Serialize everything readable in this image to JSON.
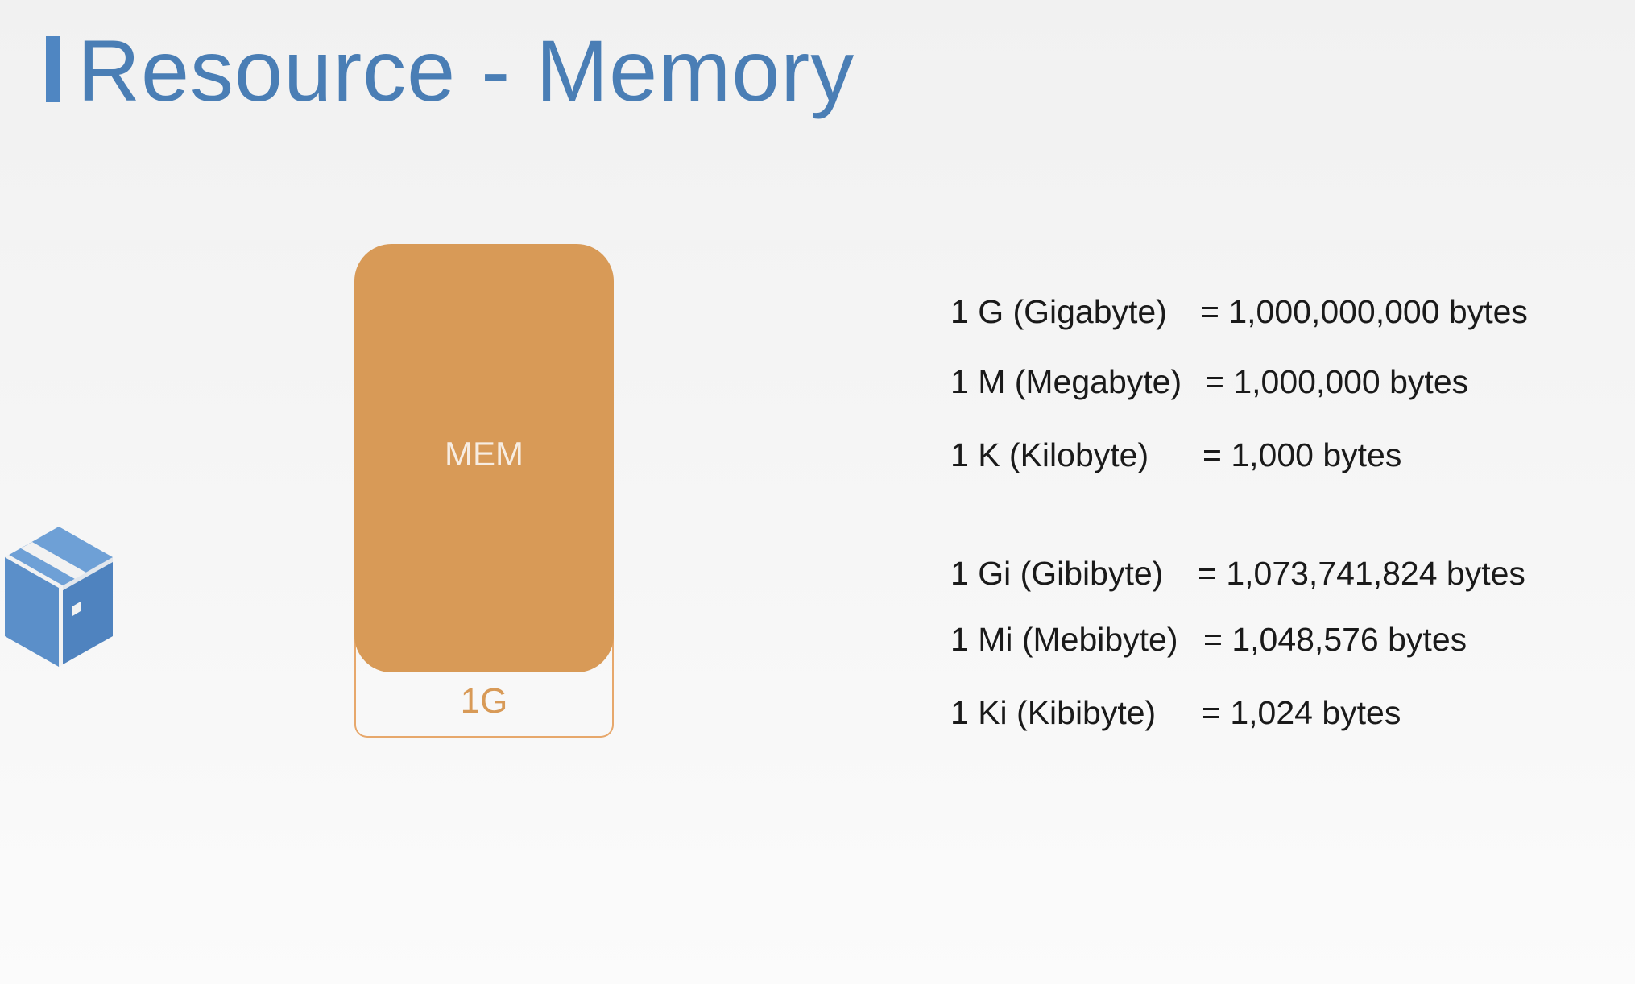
{
  "title": "Resource - Memory",
  "colors": {
    "title": "#4a7eb5",
    "accent_bar": "#4f86c2",
    "memory_block": "#d89a57",
    "memory_outline": "#e7a86c",
    "text": "#1a1a1a"
  },
  "icons": [
    "pod-box-icon"
  ],
  "memory_block": {
    "label": "MEM",
    "limit": "1G"
  },
  "units": {
    "decimal": [
      {
        "name": "1 G (Gigabyte)",
        "value": "= 1,000,000,000 bytes"
      },
      {
        "name": "1 M (Megabyte)",
        "value": "= 1,000,000 bytes"
      },
      {
        "name": "1 K (Kilobyte)",
        "value": "= 1,000 bytes"
      }
    ],
    "binary": [
      {
        "name": "1 Gi (Gibibyte)",
        "value": "= 1,073,741,824 bytes"
      },
      {
        "name": "1 Mi (Mebibyte)",
        "value": "= 1,048,576 bytes"
      },
      {
        "name": "1 Ki (Kibibyte)",
        "value": "= 1,024 bytes"
      }
    ]
  }
}
